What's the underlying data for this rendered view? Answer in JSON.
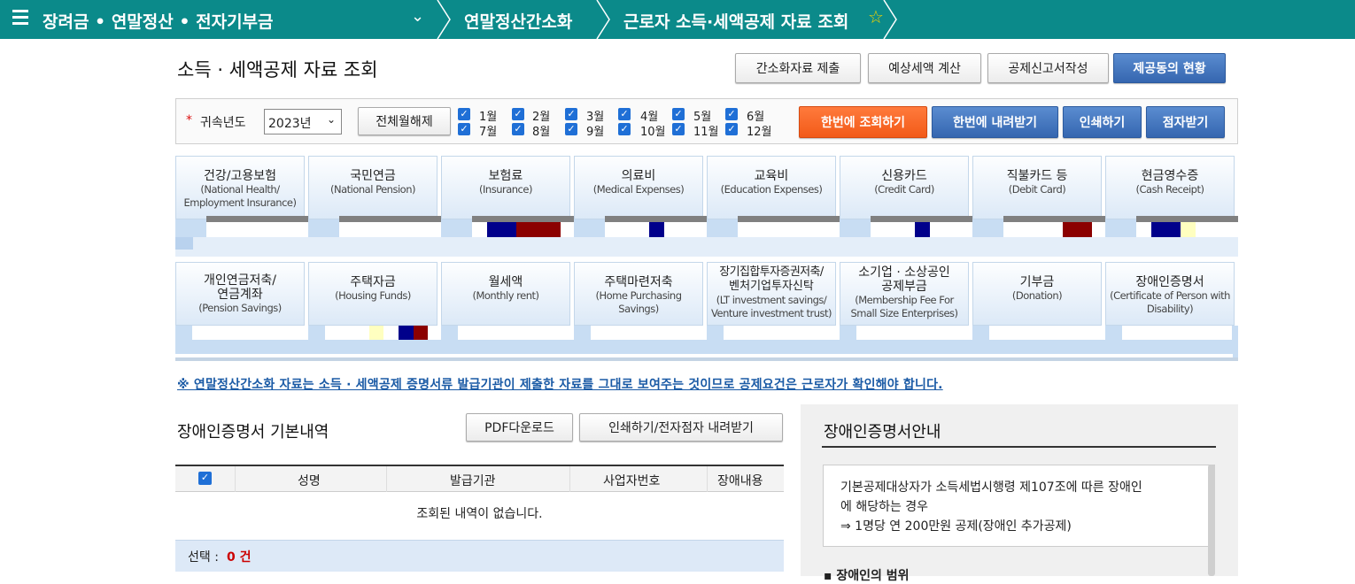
{
  "nav": {
    "crumb1": "장려금 • 연말정산 • 전자기부금",
    "crumb2": "연말정산간소화",
    "crumb3": "근로자 소득·세액공제 자료 조회"
  },
  "page": {
    "title": "소득 · 세액공제 자료 조회"
  },
  "actions": {
    "submit": "간소화자료 제출",
    "estimate": "예상세액 계산",
    "form": "공제신고서작성",
    "status": "제공동의 현황"
  },
  "search": {
    "required_mark": "*",
    "year_label": "귀속년도",
    "year_value": "2023년",
    "toggle_all": "전체월해제",
    "months": [
      "1월",
      "2월",
      "3월",
      "4월",
      "5월",
      "6월",
      "7월",
      "8월",
      "9월",
      "10월",
      "11월",
      "12월"
    ],
    "query_all": "한번에 조회하기",
    "download_all": "한번에 내려받기",
    "print": "인쇄하기",
    "braille": "점자받기"
  },
  "categories_row1": [
    {
      "k": "건강/고용보험",
      "e1": "(National Health/",
      "e2": "Employment Insurance)"
    },
    {
      "k": "국민연금",
      "e1": "(National Pension)",
      "e2": ""
    },
    {
      "k": "보험료",
      "e1": "(Insurance)",
      "e2": ""
    },
    {
      "k": "의료비",
      "e1": "(Medical Expenses)",
      "e2": ""
    },
    {
      "k": "교육비",
      "e1": "(Education Expenses)",
      "e2": ""
    },
    {
      "k": "신용카드",
      "e1": "(Credit Card)",
      "e2": ""
    },
    {
      "k": "직불카드 등",
      "e1": "(Debit Card)",
      "e2": ""
    },
    {
      "k": "현금영수증",
      "e1": "(Cash Receipt)",
      "e2": ""
    }
  ],
  "categories_row2": [
    {
      "k": "개인연금저축/",
      "k2": "연금계좌",
      "e1": "(Pension Savings)",
      "e2": ""
    },
    {
      "k": "주택자금",
      "k2": "",
      "e1": "(Housing Funds)",
      "e2": ""
    },
    {
      "k": "월세액",
      "k2": "",
      "e1": "(Monthly rent)",
      "e2": ""
    },
    {
      "k": "주택마련저축",
      "k2": "",
      "e1": "(Home Purchasing",
      "e2": "Savings)"
    },
    {
      "k": "장기집합투자증권저축/",
      "k2": "벤처기업투자신탁",
      "e1": "(LT investment savings/",
      "e2": "Venture investment trust)"
    },
    {
      "k": "소기업 · 소상공인",
      "k2": "공제부금",
      "e1": "(Membership Fee For",
      "e2": "Small Size Enterprises)"
    },
    {
      "k": "기부금",
      "k2": "",
      "e1": "(Donation)",
      "e2": ""
    },
    {
      "k": "장애인증명서",
      "k2": "",
      "e1": "(Certificate of Person with",
      "e2": "Disability)"
    }
  ],
  "notice": "※ 연말정산간소화 자료는 소득 · 세액공제 증명서류 발급기관이 제출한 자료를 그대로 보여주는 것이므로 공제요건은 근로자가 확인해야 합니다.",
  "detail": {
    "title": "장애인증명서 기본내역",
    "pdf_button": "PDF다운로드",
    "print_button": "인쇄하기/전자점자 내려받기",
    "columns": [
      "성명",
      "발급기관",
      "사업자번호",
      "장애내용"
    ],
    "empty": "조회된 내역이 없습니다.",
    "selected_label": "선택 :",
    "selected_count": "0 건"
  },
  "guide": {
    "title": "장애인증명서안내",
    "line1": "기본공제대상자가 소득세법시행령 제107조에 따른 장애인",
    "line2": "에 해당하는 경우",
    "line3": "⇒ 1명당 연 200만원 공제(장애인 추가공제)",
    "bullet": "장애인의 범위"
  },
  "colors": {
    "teal": "#0b8a8a",
    "navy": "#00008b",
    "maroon": "#8b0000",
    "cream": "#ffffc0"
  }
}
